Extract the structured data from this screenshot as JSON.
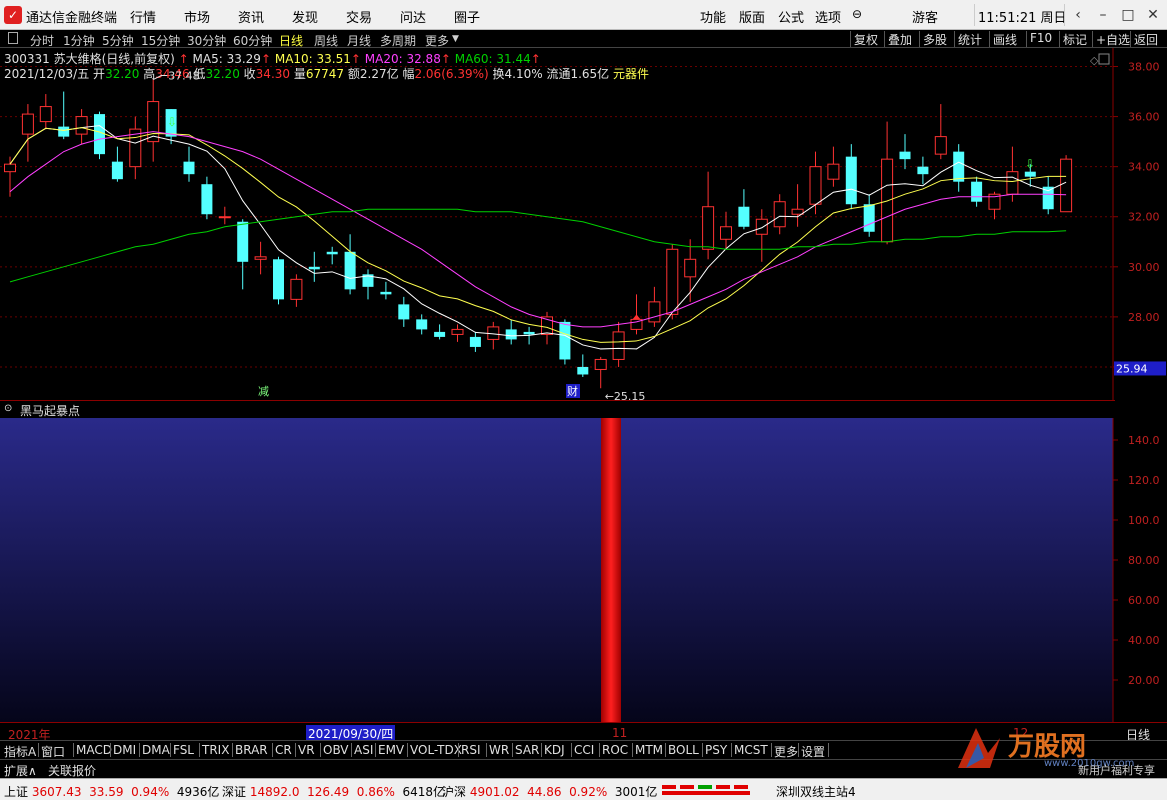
{
  "app": {
    "title": "通达信金融终端",
    "menus": [
      "行情",
      "市场",
      "资讯",
      "发现",
      "交易",
      "问达",
      "圈子"
    ],
    "right_menus": [
      "功能",
      "版面",
      "公式",
      "选项"
    ],
    "user": "游客",
    "clock": "11:51:21 周日",
    "window_buttons": [
      "back-icon",
      "minimize-icon",
      "maximize-icon",
      "close-icon"
    ]
  },
  "periods": {
    "items": [
      "分时",
      "1分钟",
      "5分钟",
      "15分钟",
      "30分钟",
      "60分钟",
      "日线",
      "周线",
      "月线",
      "多周期",
      "更多"
    ],
    "active": "日线",
    "right_buttons": [
      "复权",
      "叠加",
      "多股",
      "统计",
      "画线",
      "F10",
      "标记",
      "+自选",
      "返回"
    ]
  },
  "stock": {
    "code_name": "300331 苏大维格(日线,前复权)",
    "ma5": "MA5: 33.29",
    "ma10": "MA10: 33.51",
    "ma20": "MA20: 32.88",
    "ma60": "MA60: 31.44",
    "date": "2021/12/03/五",
    "open_label": "开",
    "open": "32.20",
    "high_label": "高",
    "high": "34.46",
    "low_label": "低",
    "low": "32.20",
    "close_label": "收",
    "close": "34.30",
    "vol_label": "量",
    "vol": "67747",
    "amount": "额2.27亿",
    "chg_label": "幅",
    "chg": "2.06(6.39%)",
    "turnover": "换4.10%",
    "float": "流通1.65亿",
    "tag": "元器件",
    "max_price_label": "37.48",
    "min_price_label": "25.15",
    "current_price": "25.94",
    "marker_jian": "减",
    "marker_cai": "财"
  },
  "colors": {
    "up": "#ff3232",
    "down": "#54ffff",
    "ma5": "#ffffff",
    "ma10": "#ffff50",
    "ma20": "#ff40ff",
    "ma60": "#00d000",
    "axis": "#8b0000"
  },
  "indicator": {
    "name": "黑马起暴点",
    "ticks": [
      "140.0",
      "120.0",
      "100.0",
      "80.00",
      "60.00",
      "40.00",
      "20.00"
    ]
  },
  "date_axis": {
    "year": "2021年",
    "cursor_date": "2021/09/30/四",
    "m11": "11",
    "m12": "12",
    "period": "日线"
  },
  "indicator_tabs": [
    "指标A",
    "窗口",
    "MACD",
    "DMI",
    "DMA",
    "FSL",
    "TRIX",
    "BRAR",
    "CR",
    "VR",
    "OBV",
    "ASI",
    "EMV",
    "VOL-TDX",
    "RSI",
    "WR",
    "SAR",
    "KDJ",
    "CCI",
    "ROC",
    "MTM",
    "BOLL",
    "PSY",
    "MCST",
    "更多",
    "设置"
  ],
  "ext_tabs": [
    "扩展∧",
    "关联报价"
  ],
  "status": {
    "sh_label": "上证",
    "sh_price": "3607.43",
    "sh_chg": "33.59",
    "sh_pct": "0.94%",
    "sh_amt": "4936亿",
    "sz_label": "深证",
    "sz_price": "14892.0",
    "sz_chg": "126.49",
    "sz_pct": "0.86%",
    "sz_amt": "6418亿",
    "hs_label": "沪深",
    "hs_price": "4901.02",
    "hs_chg": "44.86",
    "hs_pct": "0.92%",
    "hs_amt": "3001亿",
    "server": "深圳双线主站4"
  },
  "watermark": {
    "brand": "万股网",
    "url": "www.2010gw.com",
    "hint": "新用户福利专享"
  },
  "chart_data": {
    "type": "candlestick",
    "ylim": [
      25,
      38.5
    ],
    "y_ticks": [
      26,
      28,
      30,
      32,
      34,
      36,
      38
    ],
    "candles": [
      {
        "o": 33.8,
        "h": 34.4,
        "l": 32.8,
        "c": 34.1
      },
      {
        "o": 35.3,
        "h": 36.5,
        "l": 34.2,
        "c": 36.1
      },
      {
        "o": 35.8,
        "h": 36.9,
        "l": 35.5,
        "c": 36.4
      },
      {
        "o": 35.6,
        "h": 37.0,
        "l": 35.1,
        "c": 35.2
      },
      {
        "o": 35.3,
        "h": 36.3,
        "l": 34.9,
        "c": 36.0
      },
      {
        "o": 36.1,
        "h": 36.2,
        "l": 34.3,
        "c": 34.5
      },
      {
        "o": 34.2,
        "h": 34.8,
        "l": 33.4,
        "c": 33.5
      },
      {
        "o": 34.0,
        "h": 36.0,
        "l": 33.5,
        "c": 35.5
      },
      {
        "o": 35.0,
        "h": 37.48,
        "l": 34.2,
        "c": 36.6
      },
      {
        "o": 36.3,
        "h": 36.3,
        "l": 34.9,
        "c": 35.2
      },
      {
        "o": 34.2,
        "h": 34.8,
        "l": 33.4,
        "c": 33.7
      },
      {
        "o": 33.3,
        "h": 33.6,
        "l": 31.9,
        "c": 32.1
      },
      {
        "o": 32.0,
        "h": 32.4,
        "l": 31.7,
        "c": 32.0
      },
      {
        "o": 31.8,
        "h": 31.9,
        "l": 29.1,
        "c": 30.2
      },
      {
        "o": 30.3,
        "h": 31.0,
        "l": 29.7,
        "c": 30.4
      },
      {
        "o": 30.3,
        "h": 30.4,
        "l": 28.5,
        "c": 28.7
      },
      {
        "o": 28.7,
        "h": 29.7,
        "l": 28.4,
        "c": 29.5
      },
      {
        "o": 30.0,
        "h": 30.6,
        "l": 29.4,
        "c": 29.9
      },
      {
        "o": 30.6,
        "h": 30.8,
        "l": 30.1,
        "c": 30.5
      },
      {
        "o": 30.6,
        "h": 31.3,
        "l": 28.9,
        "c": 29.1
      },
      {
        "o": 29.7,
        "h": 29.9,
        "l": 28.7,
        "c": 29.2
      },
      {
        "o": 29.0,
        "h": 29.4,
        "l": 28.7,
        "c": 28.9
      },
      {
        "o": 28.5,
        "h": 28.8,
        "l": 27.6,
        "c": 27.9
      },
      {
        "o": 27.9,
        "h": 28.1,
        "l": 27.3,
        "c": 27.5
      },
      {
        "o": 27.4,
        "h": 27.7,
        "l": 27.1,
        "c": 27.2
      },
      {
        "o": 27.3,
        "h": 27.7,
        "l": 27.0,
        "c": 27.5
      },
      {
        "o": 27.2,
        "h": 27.4,
        "l": 26.6,
        "c": 26.8
      },
      {
        "o": 27.1,
        "h": 27.8,
        "l": 26.7,
        "c": 27.6
      },
      {
        "o": 27.5,
        "h": 27.9,
        "l": 26.9,
        "c": 27.1
      },
      {
        "o": 27.4,
        "h": 27.6,
        "l": 26.9,
        "c": 27.3
      },
      {
        "o": 27.3,
        "h": 28.2,
        "l": 26.9,
        "c": 28.0
      },
      {
        "o": 27.8,
        "h": 27.9,
        "l": 26.1,
        "c": 26.3
      },
      {
        "o": 26.0,
        "h": 26.5,
        "l": 25.6,
        "c": 25.7
      },
      {
        "o": 25.9,
        "h": 26.4,
        "l": 25.15,
        "c": 26.3
      },
      {
        "o": 26.3,
        "h": 27.8,
        "l": 26.0,
        "c": 27.4
      },
      {
        "o": 27.5,
        "h": 28.9,
        "l": 27.3,
        "c": 27.9
      },
      {
        "o": 27.8,
        "h": 29.2,
        "l": 27.6,
        "c": 28.6
      },
      {
        "o": 28.1,
        "h": 30.9,
        "l": 27.9,
        "c": 30.7
      },
      {
        "o": 29.6,
        "h": 31.1,
        "l": 28.6,
        "c": 30.3
      },
      {
        "o": 30.7,
        "h": 33.8,
        "l": 30.3,
        "c": 32.4
      },
      {
        "o": 31.1,
        "h": 32.2,
        "l": 30.7,
        "c": 31.6
      },
      {
        "o": 32.4,
        "h": 33.1,
        "l": 31.5,
        "c": 31.6
      },
      {
        "o": 31.3,
        "h": 32.3,
        "l": 30.2,
        "c": 31.9
      },
      {
        "o": 31.6,
        "h": 32.9,
        "l": 31.3,
        "c": 32.6
      },
      {
        "o": 32.1,
        "h": 33.3,
        "l": 31.6,
        "c": 32.3
      },
      {
        "o": 32.5,
        "h": 34.6,
        "l": 32.1,
        "c": 34.0
      },
      {
        "o": 33.5,
        "h": 34.8,
        "l": 33.2,
        "c": 34.1
      },
      {
        "o": 34.4,
        "h": 34.9,
        "l": 32.3,
        "c": 32.5
      },
      {
        "o": 32.5,
        "h": 32.9,
        "l": 31.2,
        "c": 31.4
      },
      {
        "o": 31.0,
        "h": 35.8,
        "l": 30.9,
        "c": 34.3
      },
      {
        "o": 34.6,
        "h": 35.3,
        "l": 33.9,
        "c": 34.3
      },
      {
        "o": 34.0,
        "h": 34.4,
        "l": 33.3,
        "c": 33.7
      },
      {
        "o": 34.5,
        "h": 36.5,
        "l": 34.3,
        "c": 35.2
      },
      {
        "o": 34.6,
        "h": 34.9,
        "l": 33.0,
        "c": 33.4
      },
      {
        "o": 33.4,
        "h": 33.6,
        "l": 32.4,
        "c": 32.6
      },
      {
        "o": 32.3,
        "h": 33.0,
        "l": 31.9,
        "c": 32.9
      },
      {
        "o": 32.9,
        "h": 34.8,
        "l": 32.6,
        "c": 33.8
      },
      {
        "o": 33.8,
        "h": 34.1,
        "l": 33.2,
        "c": 33.6
      },
      {
        "o": 33.2,
        "h": 33.6,
        "l": 32.1,
        "c": 32.3
      },
      {
        "o": 32.2,
        "h": 34.46,
        "l": 32.2,
        "c": 34.3
      }
    ],
    "ma5_last": 33.29,
    "ma10_last": 33.51,
    "ma20_last": 32.88,
    "ma60_last": 31.44,
    "indicator": {
      "ylim": [
        0,
        150
      ],
      "signal_index": 34,
      "signal_value": 150
    }
  }
}
